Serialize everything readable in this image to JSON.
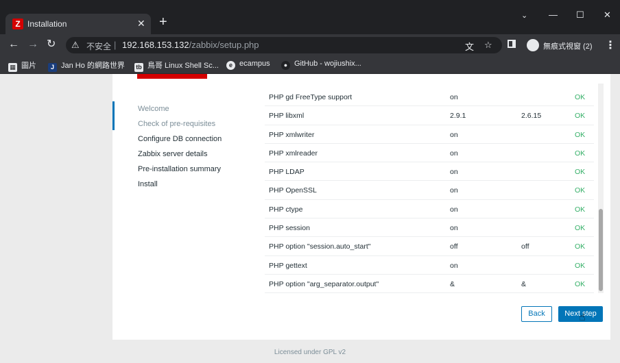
{
  "browser": {
    "tab": {
      "favicon": "Z",
      "title": "Installation"
    },
    "window_controls": {
      "tabs_menu": "⌄",
      "minimize": "—",
      "maximize": "☐",
      "close": "✕"
    },
    "toolbar": {
      "back": "←",
      "forward": "→",
      "reload": "↻",
      "insecure_label": "不安全",
      "url_host": "192.168.153.132",
      "url_path": "/zabbix/setup.php",
      "translate_icon": "translate-icon",
      "bookmark_star": "☆",
      "profile_label": "無痕式視窗 (2)",
      "menu": "⋮"
    },
    "bookmarks": [
      {
        "icon": "apps-icon",
        "glyph": "▦",
        "label": "圖片"
      },
      {
        "icon": "jan-icon",
        "glyph": "J",
        "label": "Jan Ho 的網路世界"
      },
      {
        "icon": "tb-icon",
        "glyph": "tb",
        "label": "鳥哥 Linux Shell Sc..."
      },
      {
        "icon": "ecampus-icon",
        "glyph": "e",
        "label": "ecampus"
      },
      {
        "icon": "github-icon",
        "glyph": "●",
        "label": "GitHub - wojiushix..."
      }
    ]
  },
  "setup": {
    "steps": [
      {
        "label": "Welcome",
        "state": "done"
      },
      {
        "label": "Check of pre-requisites",
        "state": "done"
      },
      {
        "label": "Configure DB connection",
        "state": "pending"
      },
      {
        "label": "Zabbix server details",
        "state": "pending"
      },
      {
        "label": "Pre-installation summary",
        "state": "pending"
      },
      {
        "label": "Install",
        "state": "pending"
      }
    ],
    "requirements": [
      {
        "name": "PHP gd FreeType support",
        "current": "on",
        "required": "",
        "status": "OK"
      },
      {
        "name": "PHP libxml",
        "current": "2.9.1",
        "required": "2.6.15",
        "status": "OK"
      },
      {
        "name": "PHP xmlwriter",
        "current": "on",
        "required": "",
        "status": "OK"
      },
      {
        "name": "PHP xmlreader",
        "current": "on",
        "required": "",
        "status": "OK"
      },
      {
        "name": "PHP LDAP",
        "current": "on",
        "required": "",
        "status": "OK"
      },
      {
        "name": "PHP OpenSSL",
        "current": "on",
        "required": "",
        "status": "OK"
      },
      {
        "name": "PHP ctype",
        "current": "on",
        "required": "",
        "status": "OK"
      },
      {
        "name": "PHP session",
        "current": "on",
        "required": "",
        "status": "OK"
      },
      {
        "name": "PHP option \"session.auto_start\"",
        "current": "off",
        "required": "off",
        "status": "OK"
      },
      {
        "name": "PHP gettext",
        "current": "on",
        "required": "",
        "status": "OK"
      },
      {
        "name": "PHP option \"arg_separator.output\"",
        "current": "&",
        "required": "&",
        "status": "OK"
      }
    ],
    "buttons": {
      "back": "Back",
      "next": "Next step"
    },
    "footer": "Licensed under GPL v2",
    "colors": {
      "accent": "#0275b8",
      "ok": "#34af67",
      "brand": "#d40000"
    }
  }
}
